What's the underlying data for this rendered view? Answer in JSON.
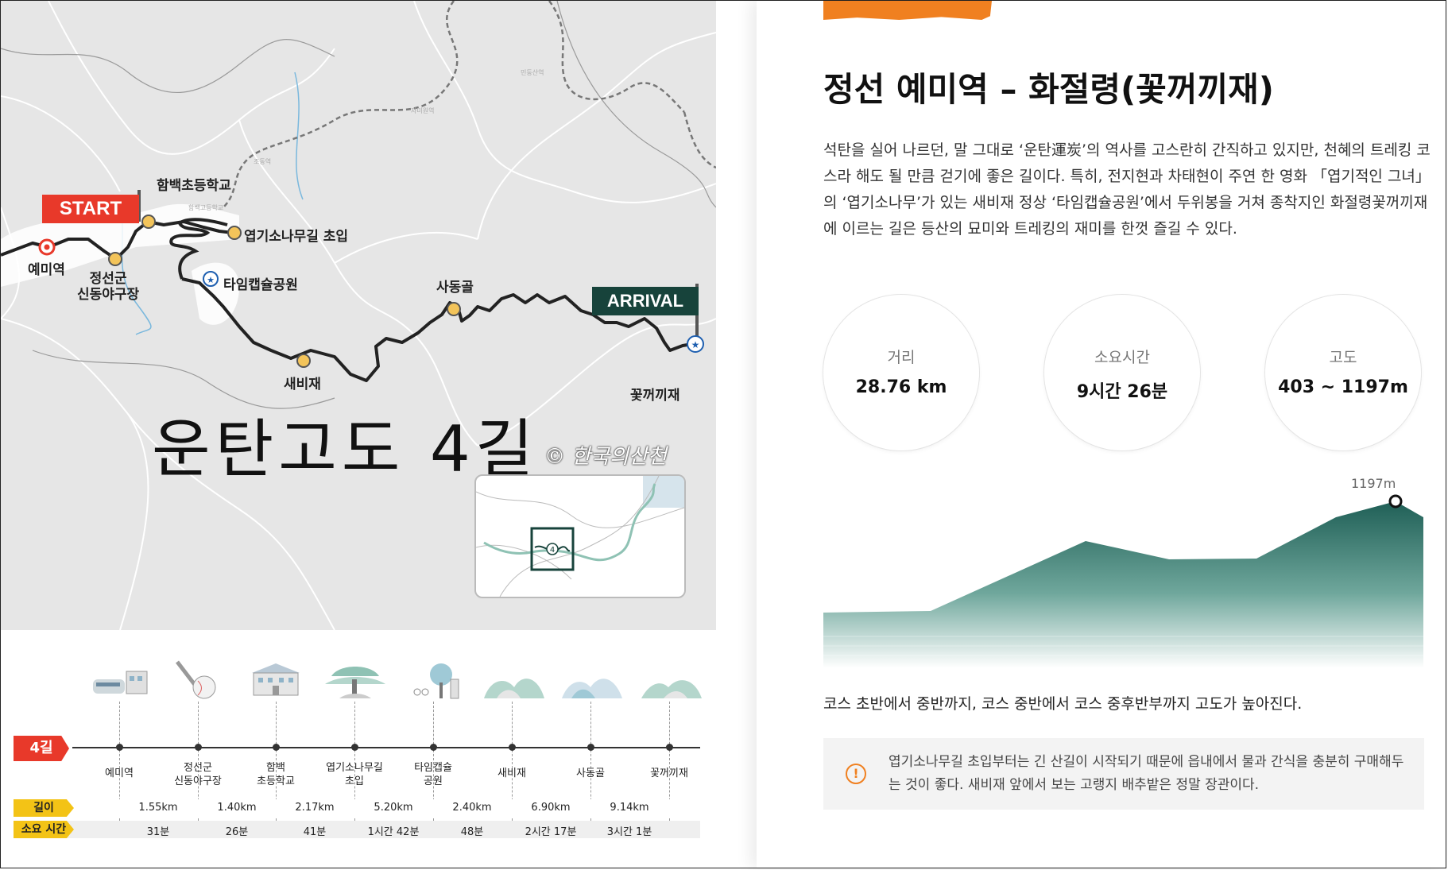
{
  "map": {
    "big_title": "운탄고도 4길",
    "watermark": "© 한국의산천",
    "start_flag": "START",
    "arrival_flag": "ARRIVAL",
    "points": {
      "yemi": "예미역",
      "hambaek": "함백초등학교",
      "jeongseon_l1": "정선군",
      "jeongseon_l2": "신동야구장",
      "yeopgi": "엽기소나무길 초입",
      "timecapsule": "타임캡슐공원",
      "saebi": "새비재",
      "sadong": "사동골",
      "kkot": "꽃꺼끼재"
    },
    "faint_labels": [
      "민둥산역",
      "자미원역",
      "조동역",
      "함백고등학교"
    ],
    "inset_number": "4",
    "colors": {
      "start": "#e8392a",
      "arrival": "#17433b",
      "route": "#222222",
      "stop_fill": "#f3c45a"
    }
  },
  "route_table": {
    "route_tag": "4길",
    "distance_label": "길이",
    "time_label": "소요 시간",
    "stops": [
      {
        "l1": "예미역",
        "l2": ""
      },
      {
        "l1": "정선군",
        "l2": "신동야구장"
      },
      {
        "l1": "함백",
        "l2": "초등학교"
      },
      {
        "l1": "엽기소나무길",
        "l2": "초입"
      },
      {
        "l1": "타임캡슐",
        "l2": "공원"
      },
      {
        "l1": "새비재",
        "l2": ""
      },
      {
        "l1": "사동골",
        "l2": ""
      },
      {
        "l1": "꽃꺼끼재",
        "l2": ""
      }
    ],
    "distances": [
      "1.55km",
      "1.40km",
      "2.17km",
      "5.20km",
      "2.40km",
      "6.90km",
      "9.14km"
    ],
    "times": [
      "31분",
      "26분",
      "41분",
      "1시간 42분",
      "48분",
      "2시간 17분",
      "3시간 1분"
    ]
  },
  "detail": {
    "title": "정선 예미역 – 화절령(꽃꺼끼재)",
    "description": "석탄을 실어 나르던, 말 그대로 ‘운탄運炭’의 역사를 고스란히 간직하고 있지만, 천혜의 트레킹 코스라 해도 될 만큼 걷기에 좋은 길이다. 특히, 전지현과 차태현이 주연 한 영화 「엽기적인 그녀」의 ‘엽기소나무’가 있는 새비재 정상 ‘타임캡슐공원’에서 두위봉을 거쳐 종착지인 화절령꽃꺼끼재에 이르는 길은 등산의 묘미와 트레킹의 재미를 한껏 즐길 수 있다.",
    "stats": [
      {
        "key": "거리",
        "value": "28.76 km"
      },
      {
        "key": "소요시간",
        "value": "9시간 26분"
      },
      {
        "key": "고도",
        "value": "403 ~ 1197m"
      }
    ],
    "peak_label": "1197m",
    "elevation_caption": "코스 초반에서 중반까지, 코스 중반에서 코스 중후반부까지 고도가 높아진다.",
    "note": "엽기소나무길 초입부터는 긴 산길이 시작되기 때문에 읍내에서 물과 간식을 충분히 구매해두는 것이 좋다. 새비재 앞에서 보는 고랭지 배추밭은 정말 장관이다.",
    "colors": {
      "accent": "#f08020",
      "elevation": "#2a6e63"
    }
  }
}
